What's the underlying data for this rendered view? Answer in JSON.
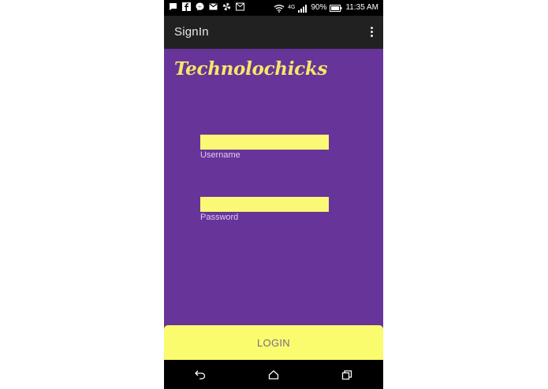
{
  "status_bar": {
    "network_label": "4G",
    "battery": "90%",
    "time": "11:35 AM",
    "left_icons": [
      "message-icon",
      "facebook-icon",
      "messenger-icon",
      "gmail-icon",
      "pinwheel-icon",
      "mail-icon"
    ]
  },
  "action_bar": {
    "title": "SignIn",
    "overflow_icon": "overflow-menu-icon"
  },
  "app": {
    "brand": "Technolochicks"
  },
  "form": {
    "username": {
      "value": "",
      "label": "Username"
    },
    "password": {
      "value": "",
      "label": "Password"
    },
    "login_label": "LOGIN"
  },
  "nav_bar": {
    "icons": [
      "back-icon",
      "home-icon",
      "recents-icon"
    ]
  },
  "colors": {
    "background": "#673499",
    "accent_yellow": "#fbf876",
    "brand_yellow": "#f6e66a",
    "action_bar": "#212121"
  }
}
